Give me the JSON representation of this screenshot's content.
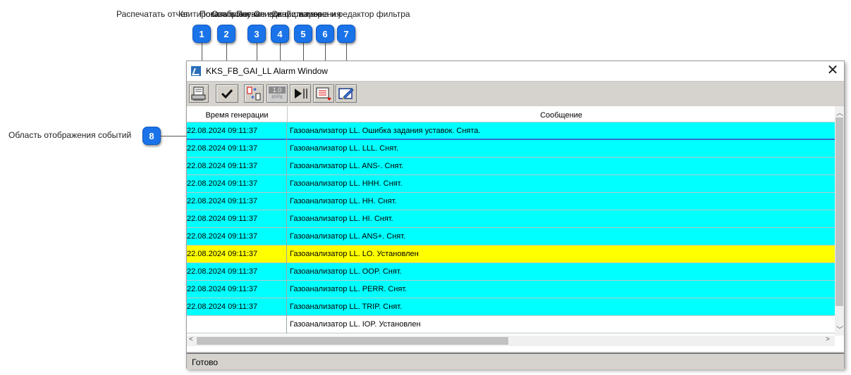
{
  "top_caption_fragments": [
    "Распечатать отчет",
    "Квитировать все",
    "Показать лог",
    "Отображение единиц измерения",
    "Пауза",
    "Список фильтров",
    "Свойства окна и редактор фильтра"
  ],
  "callouts": [
    "1",
    "2",
    "3",
    "4",
    "5",
    "6",
    "7",
    "8"
  ],
  "left_label": "Область отображения событий",
  "window": {
    "title": "KKS_FB_GAI_LL Alarm Window",
    "close": "✕",
    "units_icon_top": "1.0",
    "units_icon_bottom": "m³/s",
    "columns": [
      "Время генерации",
      "Сообщение"
    ],
    "rows": [
      {
        "time": "22.08.2024 09:11:37",
        "msg": "Газоанализатор LL. Ошибка задания уставок. Снята.",
        "color": "cyan"
      },
      {
        "time": "22.08.2024 09:11:37",
        "msg": "Газоанализатор LL. LLL. Снят.",
        "color": "cyan"
      },
      {
        "time": "22.08.2024 09:11:37",
        "msg": "Газоанализатор LL. ANS-. Снят.",
        "color": "cyan"
      },
      {
        "time": "22.08.2024 09:11:37",
        "msg": "Газоанализатор LL. HHH. Снят.",
        "color": "cyan"
      },
      {
        "time": "22.08.2024 09:11:37",
        "msg": "Газоанализатор LL. HH. Снят.",
        "color": "cyan"
      },
      {
        "time": "22.08.2024 09:11:37",
        "msg": "Газоанализатор LL. HI. Снят.",
        "color": "cyan"
      },
      {
        "time": "22.08.2024 09:11:37",
        "msg": "Газоанализатор LL. ANS+. Снят.",
        "color": "cyan"
      },
      {
        "time": "22.08.2024 09:11:37",
        "msg": "Газоанализатор LL. LO. Установлен",
        "color": "yellow"
      },
      {
        "time": "22.08.2024 09:11:37",
        "msg": "Газоанализатор LL. OOP. Снят.",
        "color": "cyan"
      },
      {
        "time": "22.08.2024 09:11:37",
        "msg": "Газоанализатор LL. PERR. Снят.",
        "color": "cyan"
      },
      {
        "time": "22.08.2024 09:11:37",
        "msg": "Газоанализатор LL. TRIP. Снят.",
        "color": "cyan"
      },
      {
        "time": "",
        "msg": "Газоанализатор LL. IOP. Установлен",
        "color": "white"
      }
    ],
    "status": "Готово"
  },
  "colors": {
    "cyan": "#00ffff",
    "yellow": "#ffff00",
    "callout": "#1a73e8"
  },
  "icons": [
    "print-icon",
    "checkmark-icon",
    "log-icon",
    "units-icon",
    "pause-icon",
    "filter-list-icon",
    "window-properties-icon"
  ]
}
